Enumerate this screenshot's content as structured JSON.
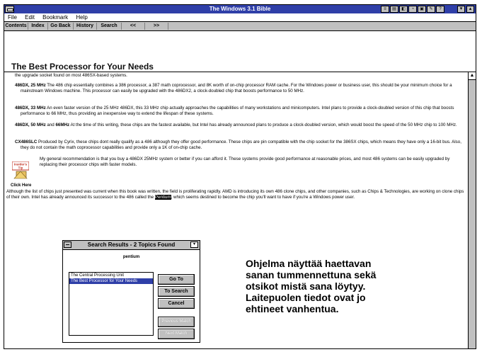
{
  "window": {
    "title": "The Windows 3.1 Bible"
  },
  "menu": [
    "File",
    "Edit",
    "Bookmark",
    "Help"
  ],
  "toolbar": [
    "Contents",
    "Index",
    "Go Back",
    "History",
    "Search",
    "<<",
    ">>"
  ],
  "heading": "The Best Processor for Your Needs",
  "paragraphs": {
    "p0": "the upgrade socket found on most 486SX-based systems.",
    "p1_bold": "486DX, 25 MHz",
    "p1": " The 486 chip essentially combines a 386 processor, a 387 math coprocessor, and 8K worth of on-chip processor RAM cache. For the Windows power or business user, this should be your minimum choice for a mainstream Windows machine. This processor can easily be upgraded with the 486DX2, a clock-doubled chip that boosts performance to 50 MHz.",
    "p2_bold": "486DX, 33 MHz",
    "p2": " An even faster version of the 25 MHz 486DX, this 33 MHz chip actually approaches the capabilities of many workstations and minicomputers. Intel plans to provide a clock-doubled version of this chip that boosts performance to 66 MHz, thus providing an inexpensive way to extend the lifespan of these systems.",
    "p3_bold_a": "486DX, 50 MHz",
    "p3_and": " and ",
    "p3_bold_b": "66MHz",
    "p3": " At the time of this writing, these chips are the fastest available, but Intel has already announced plans to produce a clock-doubled version, which would boost the speed of the 50 MHz chip to 100 MHz.",
    "p4_bold": "CX486SLC",
    "p4": " Produced by Cyrix, these chips dont really qualify as a 486 although they offer good performance. These chips are pin compatible with the chip socket for the 386SX chips, which means they have only a 16-bit bus. Also, they do not contain the math coprocessor capabilities and provide only a 1K of on-chip cache.",
    "tip_label": "Insider's Tip",
    "tip": "My general recommendation is that you buy a 486DX 25MHz system or better if you can afford it. These systems provide good performance at reasonable prices, and most 486 systems can be easily upgraded by replacing their processor chips with faster models.",
    "click_here": "Click Here",
    "p5_before": "Although the list of chips just presented was current when this book was written, the field is proliferating rapidly. AMD is introducing its own 486 clone chips, and other companies, such as Chips & Technologies, are working on clone chips of their own. Intel has already announced its successor to the 486 called the ",
    "p5_highlight": "Pentium",
    "p5_after": ", which seems destined to become the chip you'll want to have if you're a Windows power user."
  },
  "dialog": {
    "title": "Search Results - 2 Topics Found",
    "search_word": "pentium",
    "results": [
      "The Central Processing Unit",
      "The Best Processor for Your Needs"
    ],
    "selected_index": 1,
    "buttons": {
      "goto": "Go To",
      "search": "To Search",
      "cancel": "Cancel",
      "prev": "Previous Match",
      "next": "Next Match"
    }
  },
  "caption": "Ohjelma näyttää haettavan sanan tummennettuna sekä otsikot mistä sana löytyy. Laitepuolen tiedot ovat jo ehtineet vanhentua."
}
